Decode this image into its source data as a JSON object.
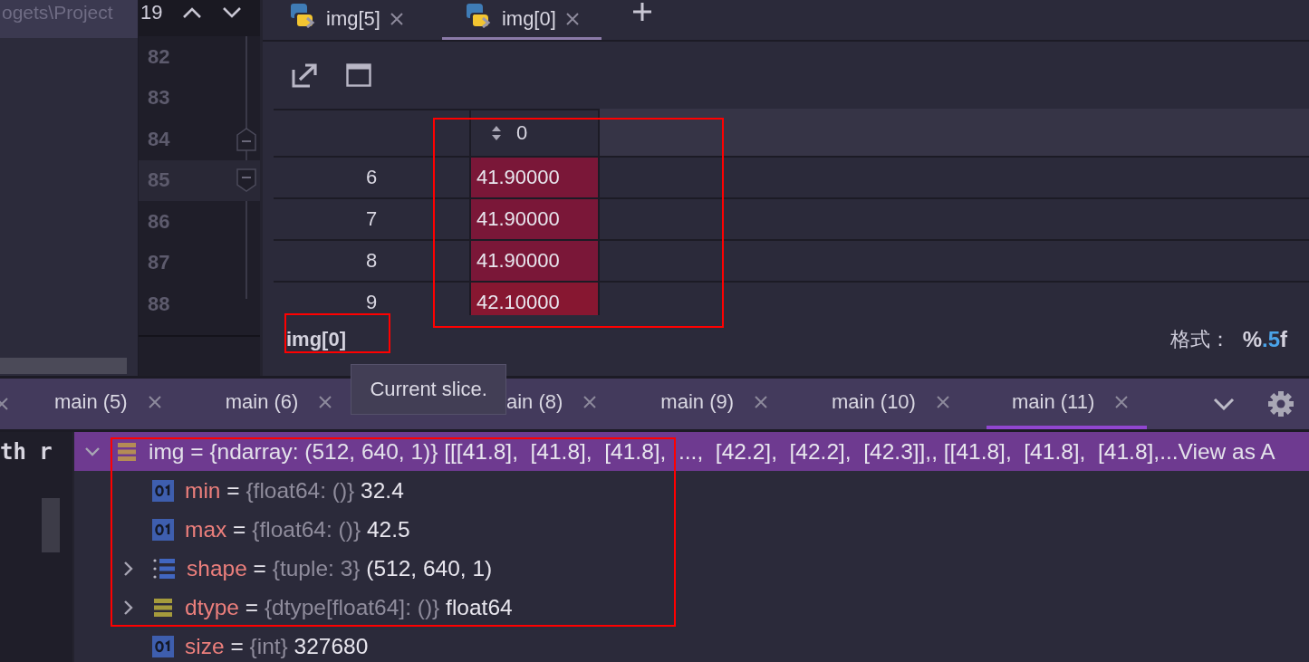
{
  "editor": {
    "path_fragment": "ogets\\Project",
    "code_fragment": "th r",
    "search_count": "19",
    "lines": [
      {
        "number": "82",
        "selected": false
      },
      {
        "number": "83",
        "selected": false
      },
      {
        "number": "84",
        "selected": false,
        "kind": "fold_start"
      },
      {
        "number": "85",
        "selected": true,
        "kind": "fold_end"
      },
      {
        "number": "86",
        "selected": false
      },
      {
        "number": "87",
        "selected": false
      },
      {
        "number": "88",
        "selected": false
      }
    ]
  },
  "viewer_tabs": [
    {
      "label": "img[5]",
      "selected": false
    },
    {
      "label": "img[0]",
      "selected": true
    }
  ],
  "table": {
    "columns": [
      "0"
    ],
    "rows": [
      {
        "index": "6",
        "value": "41.90000",
        "color": "#7a1738"
      },
      {
        "index": "7",
        "value": "41.90000",
        "color": "#7a1738"
      },
      {
        "index": "8",
        "value": "41.90000",
        "color": "#7a1738"
      },
      {
        "index": "9",
        "value": "42.10000",
        "color": "#871731"
      }
    ]
  },
  "slice": "img[0]",
  "format": {
    "label": "格式：",
    "value_parts": [
      {
        "text": "%",
        "highlight": false
      },
      {
        "text": ".5",
        "highlight": true
      },
      {
        "text": "f",
        "highlight": false
      }
    ]
  },
  "debug_tabs": [
    {
      "label": "main (5)",
      "selected": false
    },
    {
      "label": "main (6)",
      "selected": false
    },
    {
      "label": "ain (8)",
      "selected": false
    },
    {
      "label": "main (9)",
      "selected": false
    },
    {
      "label": "main (10)",
      "selected": false
    },
    {
      "label": "main (11)",
      "selected": true
    }
  ],
  "tooltip": "Current slice.",
  "variables": [
    {
      "name": "img",
      "sep": "=",
      "type": "{ndarray: (512, 640, 1)}",
      "value": "[[[41.8],  [41.8],  [41.8],  ...,  [42.2],  [42.2],  [42.3]],, [[41.8],  [41.8],  [41.8],...",
      "link": "View as A",
      "kind": "array",
      "expanded": true,
      "selected": true,
      "children": [
        {
          "name": "min",
          "sep": "=",
          "type": "{float64: ()}",
          "value": "32.4",
          "kind": "number",
          "selected": false
        },
        {
          "name": "max",
          "sep": "=",
          "type": "{float64: ()}",
          "value": "42.5",
          "kind": "number",
          "selected": false
        },
        {
          "name": "shape",
          "sep": "=",
          "type": "{tuple: 3}",
          "value": "(512, 640, 1)",
          "kind": "list",
          "expanded": false,
          "selected": false
        },
        {
          "name": "dtype",
          "sep": "=",
          "type": "{dtype[float64]: ()}",
          "value": "float64",
          "kind": "dtype",
          "expanded": false,
          "selected": false
        },
        {
          "name": "size",
          "sep": "=",
          "type": "{int}",
          "value": "327680",
          "kind": "number",
          "selected": false
        }
      ]
    }
  ]
}
